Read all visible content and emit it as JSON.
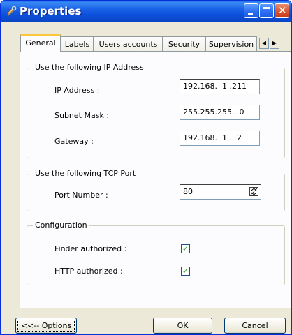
{
  "window": {
    "title": "Properties"
  },
  "tabs": [
    {
      "label": "General",
      "active": true
    },
    {
      "label": "Labels"
    },
    {
      "label": "Users accounts"
    },
    {
      "label": "Security"
    },
    {
      "label": "Supervision"
    }
  ],
  "ip_group": {
    "title": "Use the following IP Address",
    "ip_label": "IP Address :",
    "ip_value": "192.168.  1 .211",
    "subnet_label": "Subnet Mask :",
    "subnet_value": "255.255.255.  0",
    "gateway_label": "Gateway :",
    "gateway_value": "192.168.  1 .  2"
  },
  "tcp_group": {
    "title": "Use the following TCP Port",
    "port_label": "Port Number :",
    "port_value": "80"
  },
  "config_group": {
    "title": "Configuration",
    "finder_label": "Finder authorized :",
    "finder_checked": true,
    "http_label": "HTTP authorized :",
    "http_checked": true
  },
  "buttons": {
    "options": "<<-- Options",
    "ok": "OK",
    "cancel": "Cancel"
  },
  "icons": {
    "title": "tools-icon",
    "tab_left": "arrow-left-icon",
    "tab_right": "arrow-right-icon",
    "check": "✓"
  },
  "colors": {
    "titlebar": "#0a5fe5",
    "close_button": "#d9532b",
    "active_tab_accent": "#ffc83c",
    "checkmark": "#21a121"
  }
}
